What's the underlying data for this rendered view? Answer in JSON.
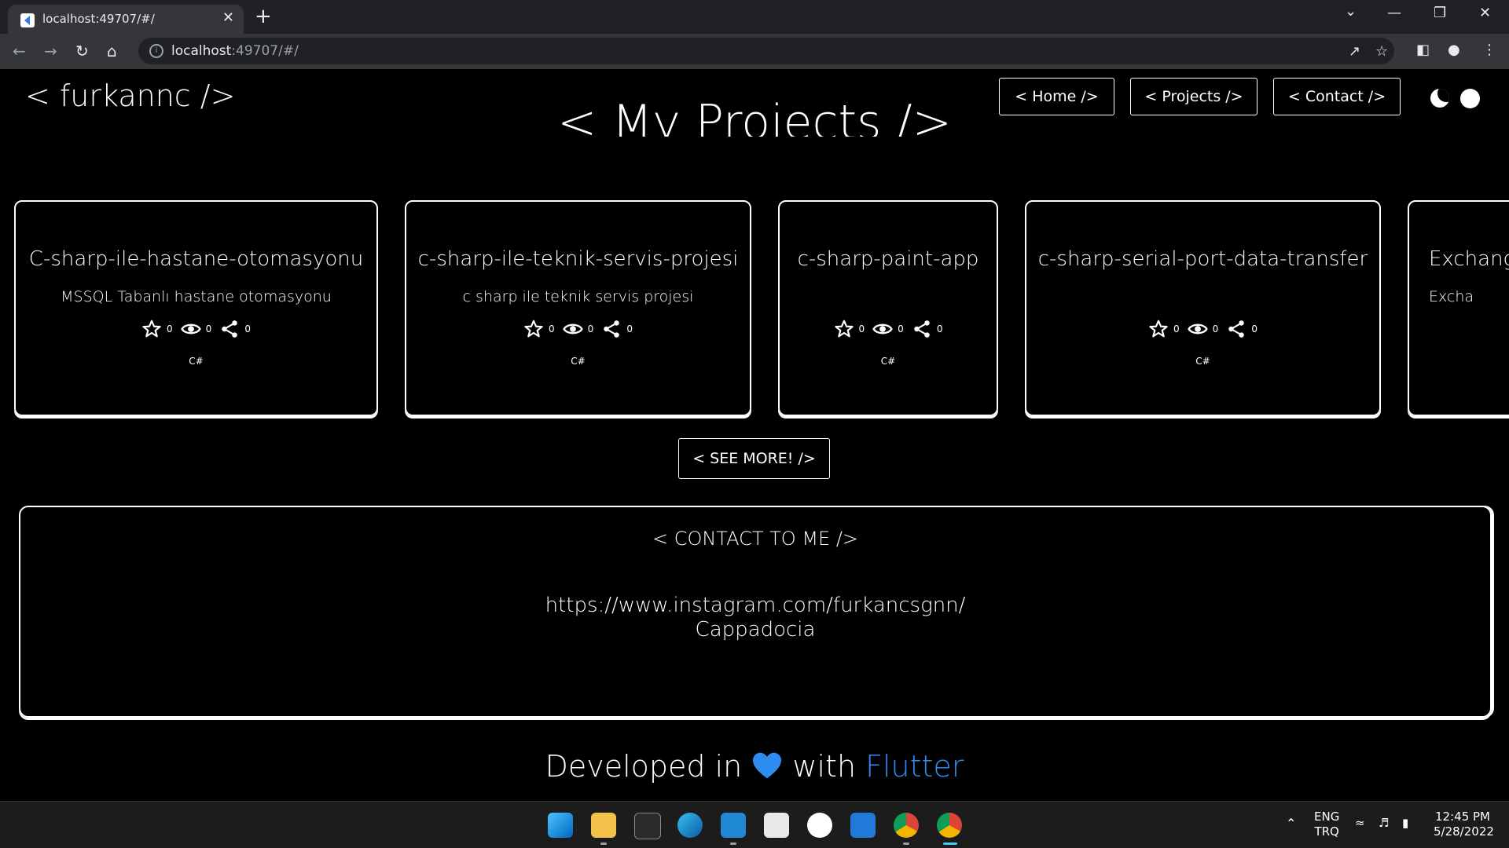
{
  "browser": {
    "tab_title": "localhost:49707/#/",
    "new_tab": "+",
    "close_tab": "✕",
    "url_host": "localhost",
    "url_rest": ":49707/#/",
    "window_controls": {
      "minimize": "—",
      "maximize": "❐",
      "close": "✕",
      "tab_search": "⌄"
    }
  },
  "site": {
    "logo": "< furkannc />",
    "nav": [
      {
        "label": "< Home />"
      },
      {
        "label": "< Projects />"
      },
      {
        "label": "< Contact />"
      }
    ],
    "section_title": "< My Projects />",
    "projects": [
      {
        "title": "C-sharp-ile-hastane-otomasyonu",
        "description": "MSSQL Tabanlı hastane otomasyonu",
        "stars": "0",
        "watchers": "0",
        "forks": "0",
        "language": "C#"
      },
      {
        "title": "c-sharp-ile-teknik-servis-projesi",
        "description": "c sharp ile teknik servis projesi",
        "stars": "0",
        "watchers": "0",
        "forks": "0",
        "language": "C#"
      },
      {
        "title": "c-sharp-paint-app",
        "description": "",
        "stars": "0",
        "watchers": "0",
        "forks": "0",
        "language": "C#"
      },
      {
        "title": "c-sharp-serial-port-data-transfer",
        "description": "",
        "stars": "0",
        "watchers": "0",
        "forks": "0",
        "language": "C#"
      },
      {
        "title": "Exchang",
        "description": "Excha",
        "stars": "",
        "watchers": "",
        "forks": "",
        "language": ""
      }
    ],
    "see_more": "< SEE MORE! />",
    "contact": {
      "title": "< CONTACT TO ME />",
      "link": "https://www.instagram.com/furkancsgnn/",
      "location": "Cappadocia"
    },
    "footer": {
      "prefix": "Developed in",
      "middle": "with",
      "brand": "Flutter"
    }
  },
  "taskbar": {
    "lang_top": "ENG",
    "lang_bottom": "TRQ",
    "time": "12:45 PM",
    "date": "5/28/2022"
  },
  "colors": {
    "background": "#000000",
    "text": "#ffffff",
    "accent": "#2e8bf0",
    "chrome": "#35363a"
  }
}
